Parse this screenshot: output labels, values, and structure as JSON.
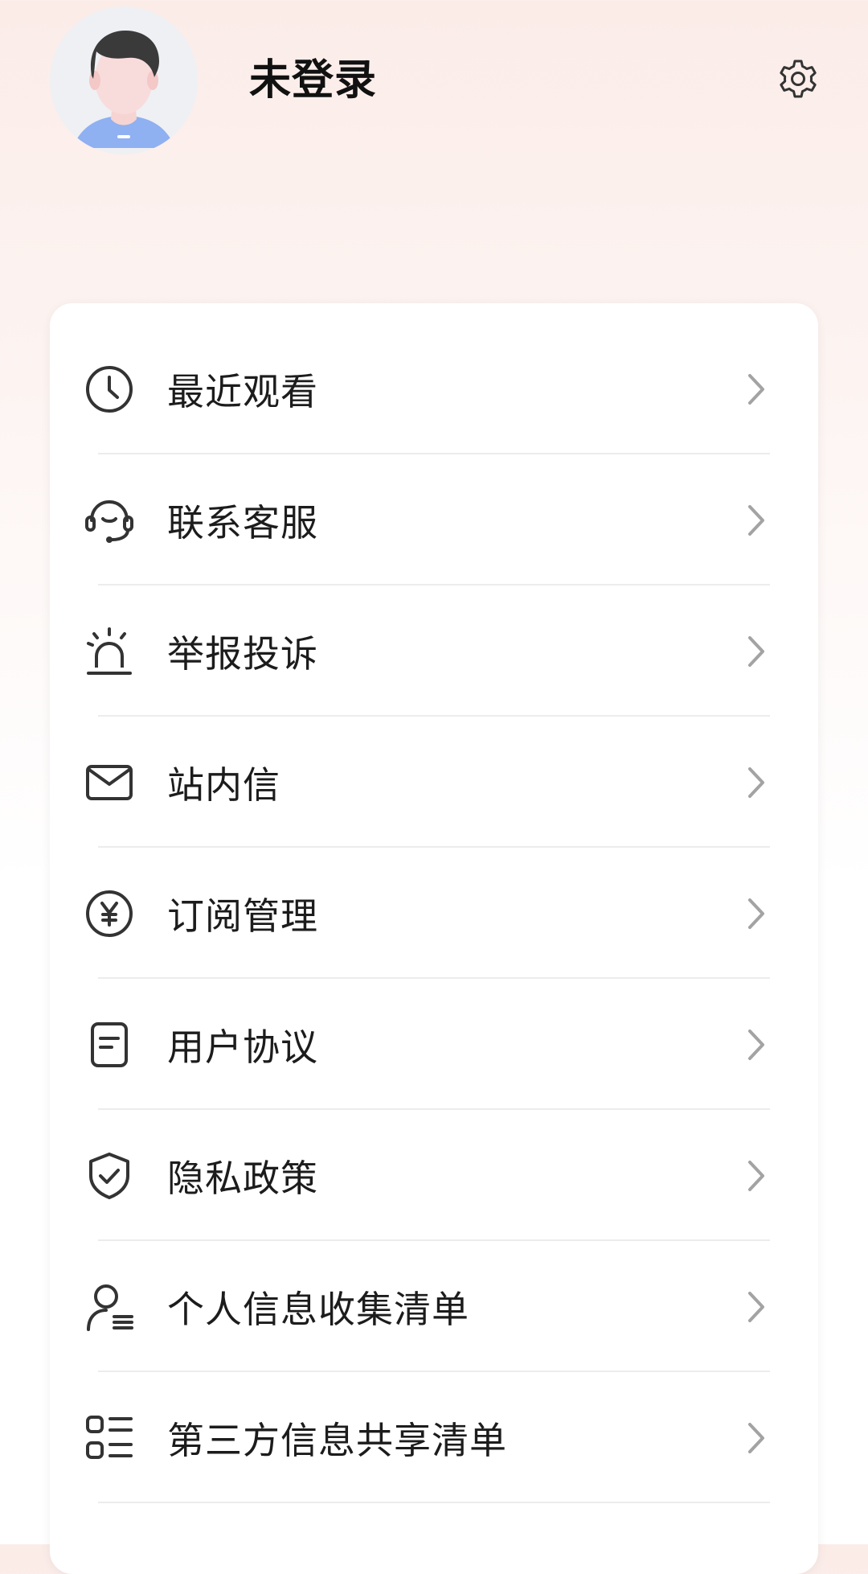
{
  "profile": {
    "username": "未登录",
    "avatar_icon": "default-user-avatar",
    "settings_icon": "gear-icon"
  },
  "menu": {
    "items": [
      {
        "label": "最近观看",
        "icon": "clock-icon"
      },
      {
        "label": "联系客服",
        "icon": "headset-icon"
      },
      {
        "label": "举报投诉",
        "icon": "alarm-icon"
      },
      {
        "label": "站内信",
        "icon": "mail-icon"
      },
      {
        "label": "订阅管理",
        "icon": "yen-coin-icon"
      },
      {
        "label": "用户协议",
        "icon": "document-icon"
      },
      {
        "label": "隐私政策",
        "icon": "shield-check-icon"
      },
      {
        "label": "个人信息收集清单",
        "icon": "person-list-icon"
      },
      {
        "label": "第三方信息共享清单",
        "icon": "list-icon"
      }
    ]
  },
  "colors": {
    "text": "#1c1c1c",
    "icon": "#333333",
    "chevron": "#a3a3a3",
    "header_tint": "#fbece8"
  }
}
